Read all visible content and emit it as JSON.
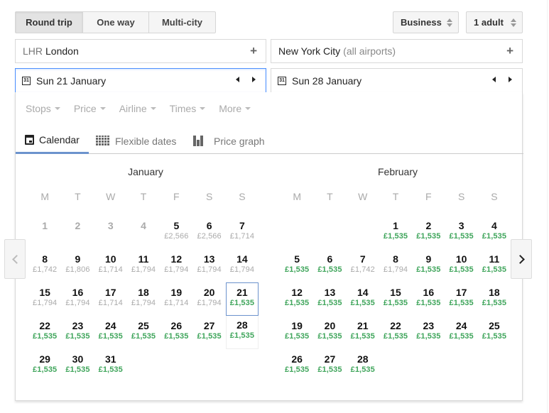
{
  "trip_type": {
    "options": [
      "Round trip",
      "One way",
      "Multi-city"
    ],
    "selected": "Round trip"
  },
  "cabin_class": {
    "value": "Business"
  },
  "passengers": {
    "value": "1 adult"
  },
  "origin": {
    "code": "LHR",
    "city": "London"
  },
  "destination": {
    "city": "New York City",
    "qualifier": "(all airports)"
  },
  "departure_date": "Sun 21 January",
  "return_date": "Sun 28 January",
  "icons": {
    "calendar_small": "31"
  },
  "filters": [
    "Stops",
    "Price",
    "Airline",
    "Times",
    "More"
  ],
  "tabs": [
    {
      "label": "Calendar",
      "icon": "calendar-icon",
      "active": true
    },
    {
      "label": "Flexible dates",
      "icon": "grid-icon",
      "active": false
    },
    {
      "label": "Price graph",
      "icon": "bar-chart-icon",
      "active": false
    }
  ],
  "weekdays": [
    "M",
    "T",
    "W",
    "T",
    "F",
    "S",
    "S"
  ],
  "price_colors": {
    "cheapest": "#3fa55b",
    "normal": "#aaaaaa",
    "selection": "#6c93cd"
  },
  "months": [
    {
      "name": "January",
      "offset": 0,
      "days": [
        {
          "d": "1",
          "price": "",
          "state": "disabled"
        },
        {
          "d": "2",
          "price": "",
          "state": "disabled"
        },
        {
          "d": "3",
          "price": "",
          "state": "disabled"
        },
        {
          "d": "4",
          "price": "",
          "state": "disabled"
        },
        {
          "d": "5",
          "price": "£2,566",
          "state": "normal"
        },
        {
          "d": "6",
          "price": "£2,566",
          "state": "normal"
        },
        {
          "d": "7",
          "price": "£1,714",
          "state": "normal"
        },
        {
          "d": "8",
          "price": "£1,742",
          "state": "normal"
        },
        {
          "d": "9",
          "price": "£1,806",
          "state": "normal"
        },
        {
          "d": "10",
          "price": "£1,714",
          "state": "normal"
        },
        {
          "d": "11",
          "price": "£1,794",
          "state": "normal"
        },
        {
          "d": "12",
          "price": "£1,794",
          "state": "normal"
        },
        {
          "d": "13",
          "price": "£1,794",
          "state": "normal"
        },
        {
          "d": "14",
          "price": "£1,794",
          "state": "normal"
        },
        {
          "d": "15",
          "price": "£1,794",
          "state": "normal"
        },
        {
          "d": "16",
          "price": "£1,794",
          "state": "normal"
        },
        {
          "d": "17",
          "price": "£1,714",
          "state": "normal"
        },
        {
          "d": "18",
          "price": "£1,794",
          "state": "normal"
        },
        {
          "d": "19",
          "price": "£1,714",
          "state": "normal"
        },
        {
          "d": "20",
          "price": "£1,794",
          "state": "normal"
        },
        {
          "d": "21",
          "price": "£1,535",
          "state": "cheap",
          "selected": "departure"
        },
        {
          "d": "22",
          "price": "£1,535",
          "state": "cheap"
        },
        {
          "d": "23",
          "price": "£1,535",
          "state": "cheap"
        },
        {
          "d": "24",
          "price": "£1,535",
          "state": "cheap"
        },
        {
          "d": "25",
          "price": "£1,535",
          "state": "cheap"
        },
        {
          "d": "26",
          "price": "£1,535",
          "state": "cheap"
        },
        {
          "d": "27",
          "price": "£1,535",
          "state": "cheap"
        },
        {
          "d": "28",
          "price": "£1,535",
          "state": "cheap",
          "selected": "return"
        },
        {
          "d": "29",
          "price": "£1,535",
          "state": "cheap"
        },
        {
          "d": "30",
          "price": "£1,535",
          "state": "cheap"
        },
        {
          "d": "31",
          "price": "£1,535",
          "state": "cheap"
        }
      ]
    },
    {
      "name": "February",
      "offset": 3,
      "days": [
        {
          "d": "1",
          "price": "£1,535",
          "state": "cheap"
        },
        {
          "d": "2",
          "price": "£1,535",
          "state": "cheap"
        },
        {
          "d": "3",
          "price": "£1,535",
          "state": "cheap"
        },
        {
          "d": "4",
          "price": "£1,535",
          "state": "cheap"
        },
        {
          "d": "5",
          "price": "£1,535",
          "state": "cheap"
        },
        {
          "d": "6",
          "price": "£1,535",
          "state": "cheap"
        },
        {
          "d": "7",
          "price": "£1,742",
          "state": "normal"
        },
        {
          "d": "8",
          "price": "£1,794",
          "state": "normal"
        },
        {
          "d": "9",
          "price": "£1,535",
          "state": "cheap"
        },
        {
          "d": "10",
          "price": "£1,535",
          "state": "cheap"
        },
        {
          "d": "11",
          "price": "£1,535",
          "state": "cheap"
        },
        {
          "d": "12",
          "price": "£1,535",
          "state": "cheap"
        },
        {
          "d": "13",
          "price": "£1,535",
          "state": "cheap"
        },
        {
          "d": "14",
          "price": "£1,535",
          "state": "cheap"
        },
        {
          "d": "15",
          "price": "£1,535",
          "state": "cheap"
        },
        {
          "d": "16",
          "price": "£1,535",
          "state": "cheap"
        },
        {
          "d": "17",
          "price": "£1,535",
          "state": "cheap"
        },
        {
          "d": "18",
          "price": "£1,535",
          "state": "cheap"
        },
        {
          "d": "19",
          "price": "£1,535",
          "state": "cheap"
        },
        {
          "d": "20",
          "price": "£1,535",
          "state": "cheap"
        },
        {
          "d": "21",
          "price": "£1,535",
          "state": "cheap"
        },
        {
          "d": "22",
          "price": "£1,535",
          "state": "cheap"
        },
        {
          "d": "23",
          "price": "£1,535",
          "state": "cheap"
        },
        {
          "d": "24",
          "price": "£1,535",
          "state": "cheap"
        },
        {
          "d": "25",
          "price": "£1,535",
          "state": "cheap"
        },
        {
          "d": "26",
          "price": "£1,535",
          "state": "cheap"
        },
        {
          "d": "27",
          "price": "£1,535",
          "state": "cheap"
        },
        {
          "d": "28",
          "price": "£1,535",
          "state": "cheap"
        }
      ]
    }
  ]
}
